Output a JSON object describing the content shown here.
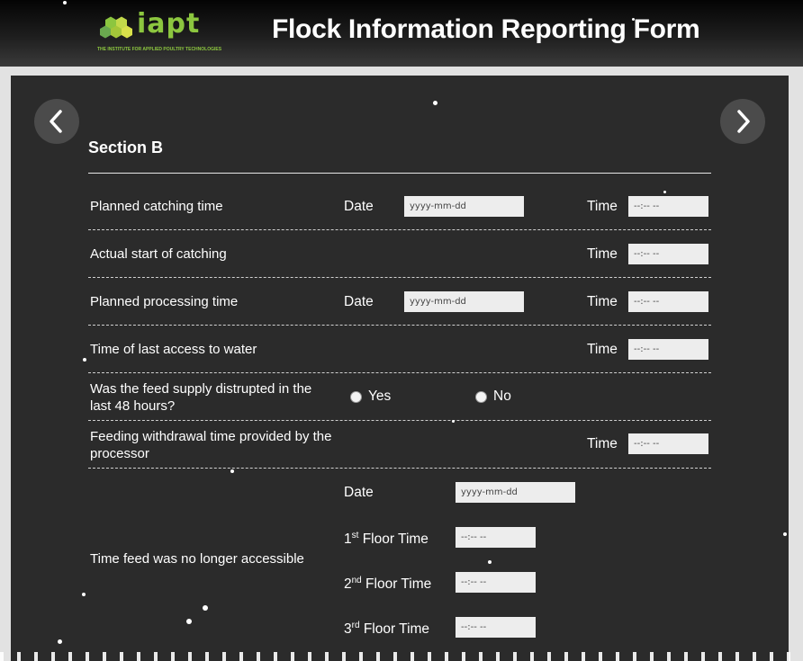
{
  "header": {
    "logo_text": "iapt",
    "logo_tagline": "THE INSTITUTE FOR APPLIED POULTRY TECHNOLOGIES",
    "title": "Flock Information Reporting Form"
  },
  "colors": {
    "brand_green": "#8cc63f",
    "panel": "#2b2b2b",
    "field": "#ededed"
  },
  "nav": {
    "prev_icon": "chevron-left-icon",
    "next_icon": "chevron-right-icon"
  },
  "section": {
    "title": "Section B",
    "common": {
      "date_label": "Date",
      "time_label": "Time",
      "date_placeholder": "yyyy-mm-dd",
      "time_placeholder": "--:-- --"
    },
    "rows": [
      {
        "label": "Planned catching time"
      },
      {
        "label": "Actual start of catching"
      },
      {
        "label": "Planned processing time"
      },
      {
        "label": "Time of last access to water"
      },
      {
        "label": "Was the feed supply distrupted in the last 48 hours?",
        "options": [
          "Yes",
          "No"
        ]
      },
      {
        "label": "Feeding withdrawal time provided by the processor"
      },
      {
        "label": "Time feed was no longer accessible",
        "floors": [
          {
            "ordinal": "1",
            "suffix": "st",
            "text": " Floor Time"
          },
          {
            "ordinal": "2",
            "suffix": "nd",
            "text": " Floor Time"
          },
          {
            "ordinal": "3",
            "suffix": "rd",
            "text": " Floor Time"
          }
        ]
      }
    ]
  }
}
